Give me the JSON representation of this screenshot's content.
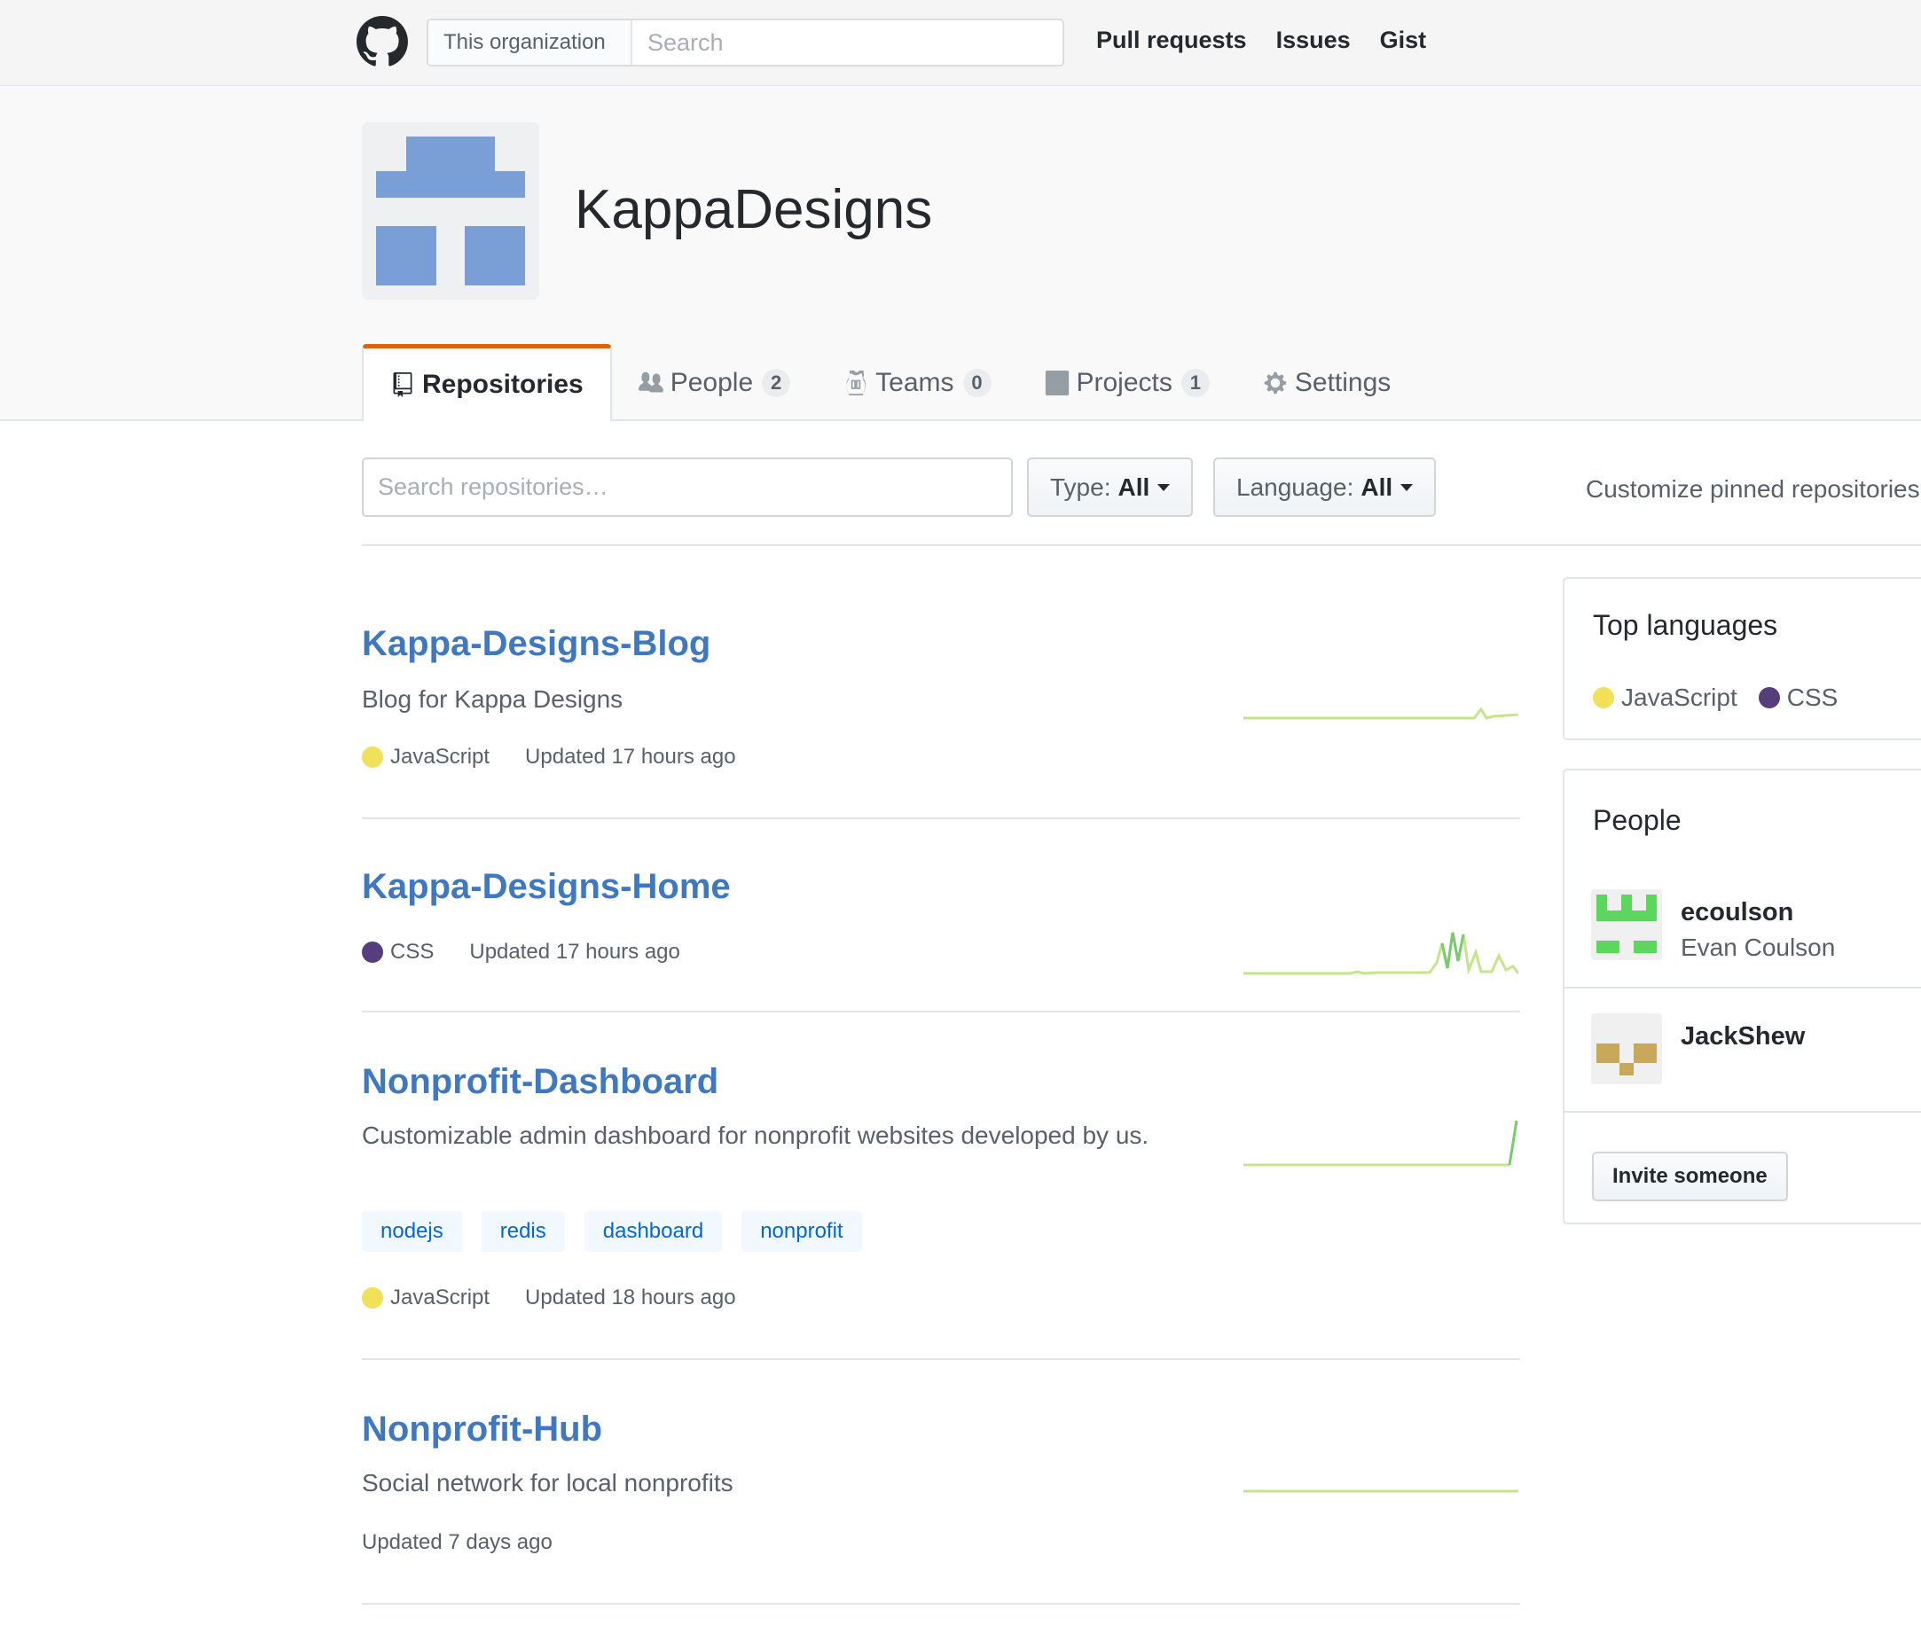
{
  "header": {
    "logo_icon": "github-octocat-icon",
    "search_scope": "This organization",
    "search_placeholder": "Search",
    "nav": [
      "Pull requests",
      "Issues",
      "Gist"
    ]
  },
  "org": {
    "name": "KappaDesigns",
    "avatar_color": "#7a9fd6"
  },
  "tabs": [
    {
      "label": "Repositories",
      "icon": "repo-icon",
      "selected": true
    },
    {
      "label": "People",
      "icon": "people-icon",
      "count": "2"
    },
    {
      "label": "Teams",
      "icon": "jersey-icon",
      "count": "0"
    },
    {
      "label": "Projects",
      "icon": "project-icon",
      "count": "1"
    },
    {
      "label": "Settings",
      "icon": "gear-icon"
    }
  ],
  "filters": {
    "search_placeholder": "Search repositories…",
    "type_label": "Type:",
    "type_value": "All",
    "language_label": "Language:",
    "language_value": "All",
    "customize": "Customize pinned repositories"
  },
  "colors": {
    "javascript": "#f1e05a",
    "css": "#563d7c",
    "link": "#4078c0",
    "tab_accent": "#e36209",
    "sparkline": "#c6e48b",
    "sparkline_dark": "#7bc96f"
  },
  "repos": [
    {
      "name": "Kappa-Designs-Blog",
      "description": "Blog for Kappa Designs",
      "language": "JavaScript",
      "updated": "Updated 17 hours ago"
    },
    {
      "name": "Kappa-Designs-Home",
      "description": "",
      "language": "CSS",
      "updated": "Updated 17 hours ago"
    },
    {
      "name": "Nonprofit-Dashboard",
      "description": "Customizable admin dashboard for nonprofit websites developed by us.",
      "topics": [
        "nodejs",
        "redis",
        "dashboard",
        "nonprofit"
      ],
      "language": "JavaScript",
      "updated": "Updated 18 hours ago"
    },
    {
      "name": "Nonprofit-Hub",
      "description": "Social network for local nonprofits",
      "language": "",
      "updated": "Updated 7 days ago"
    }
  ],
  "sidebar": {
    "top_languages_title": "Top languages",
    "languages": [
      "JavaScript",
      "CSS"
    ],
    "people_title": "People",
    "people": [
      {
        "login": "ecoulson",
        "name": "Evan Coulson",
        "avatar_color": "#5cd65c"
      },
      {
        "login": "JackShew",
        "name": "",
        "avatar_color": "#c8a85a"
      }
    ],
    "invite_label": "Invite someone"
  }
}
